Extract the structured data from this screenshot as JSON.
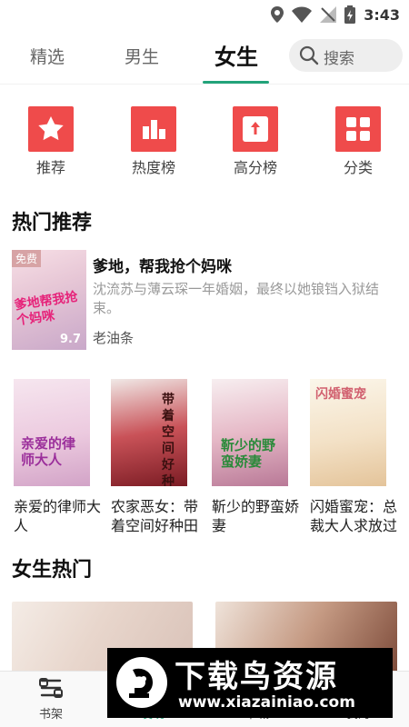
{
  "status_bar": {
    "time": "3:43"
  },
  "tabs": [
    {
      "label": "精选"
    },
    {
      "label": "男生"
    },
    {
      "label": "女生",
      "active": true
    }
  ],
  "search": {
    "label": "搜索"
  },
  "quick_nav": [
    {
      "label": "推荐",
      "icon": "star-icon"
    },
    {
      "label": "热度榜",
      "icon": "bar-chart-icon"
    },
    {
      "label": "高分榜",
      "icon": "arrow-up-icon"
    },
    {
      "label": "分类",
      "icon": "grid-icon"
    }
  ],
  "hot_recommend": {
    "title": "热门推荐",
    "featured": {
      "badge": "免费",
      "cover_text": "爹地帮我抢个妈咪",
      "score": "9.7",
      "title": "爹地，帮我抢个妈咪",
      "description": "沈流苏与薄云琛一年婚姻，最终以她锒铛入狱结束。",
      "author": "老油条"
    },
    "books": [
      {
        "title": "亲爱的律师大人",
        "cover_text": "亲爱的律师大人"
      },
      {
        "title": "农家恶女：带着空间好种田",
        "cover_text": "带着空间好种田"
      },
      {
        "title": "靳少的野蛮娇妻",
        "cover_text": "靳少的野蛮娇妻"
      },
      {
        "title": "闪婚蜜宠：总裁大人求放过",
        "cover_text": "闪婚蜜宠"
      }
    ]
  },
  "female_hot": {
    "title": "女生热门"
  },
  "bottom_nav": [
    {
      "label": "书架",
      "icon": "bookshelf-icon"
    },
    {
      "label": "发现",
      "icon": "discover-icon",
      "active": true
    },
    {
      "label": "书城",
      "icon": "bookstore-icon"
    },
    {
      "label": "我的",
      "icon": "profile-icon"
    }
  ],
  "watermark": {
    "brand": "下载鸟资源",
    "url": "www.xiazainiao.com"
  },
  "colors": {
    "accent": "#22a37a",
    "nav_icon_bg": "#ef4b4b"
  }
}
